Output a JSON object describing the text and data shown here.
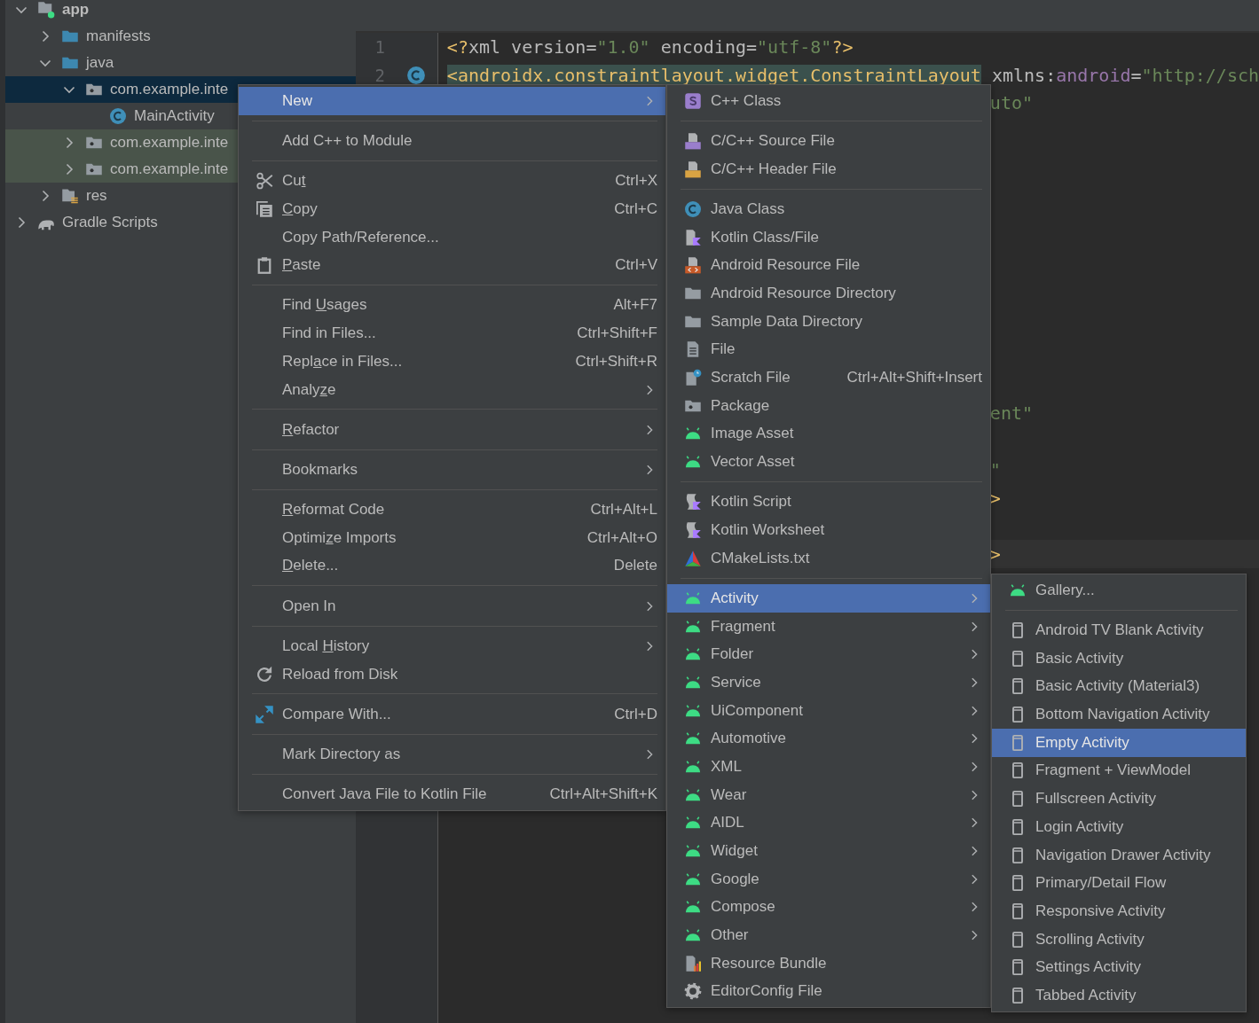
{
  "project_tree": [
    {
      "label": "app",
      "kind": "module",
      "expanded": true,
      "selected": false,
      "test": false,
      "children": [
        {
          "label": "manifests",
          "kind": "source-folder",
          "expanded": false,
          "selected": false,
          "test": false
        },
        {
          "label": "java",
          "kind": "source-folder",
          "expanded": true,
          "selected": false,
          "test": false,
          "children": [
            {
              "label": "com.example.inte",
              "kind": "package",
              "expanded": true,
              "selected": true,
              "test": false,
              "children": [
                {
                  "label": "MainActivity",
                  "kind": "class",
                  "selected": false,
                  "test": false
                }
              ]
            },
            {
              "label": "com.example.inte",
              "kind": "package",
              "expanded": false,
              "selected": false,
              "test": true
            },
            {
              "label": "com.example.inte",
              "kind": "package",
              "expanded": false,
              "selected": false,
              "test": true
            }
          ]
        },
        {
          "label": "res",
          "kind": "resources",
          "expanded": false,
          "selected": false,
          "test": false
        }
      ]
    },
    {
      "label": "Gradle Scripts",
      "kind": "gradle",
      "expanded": false,
      "selected": false,
      "test": false
    }
  ],
  "editor": {
    "lines": [
      {
        "kind": "code",
        "number": "1",
        "segments": [
          {
            "text": "<?",
            "kind": "tag"
          },
          {
            "text": "xml version=",
            "kind": "plain"
          },
          {
            "text": "\"1.0\"",
            "kind": "string"
          },
          {
            "text": " encoding=",
            "kind": "plain"
          },
          {
            "text": "\"utf-8\"",
            "kind": "string"
          },
          {
            "text": "?>",
            "kind": "tag"
          }
        ]
      },
      {
        "kind": "class-code",
        "number": "2",
        "segments": [
          {
            "text": "<androidx.constraintlayout.widget.ConstraintLayout",
            "kind": "tag",
            "highlight": true
          },
          {
            "text": " xmlns:",
            "kind": "plain"
          },
          {
            "text": "android",
            "kind": "ns"
          },
          {
            "text": "=",
            "kind": "plain"
          },
          {
            "text": "\"http://sch",
            "kind": "string"
          }
        ]
      },
      {
        "kind": "tail",
        "segments": [
          {
            "text": "uto\"",
            "kind": "string"
          }
        ]
      },
      {
        "kind": "blank"
      },
      {
        "kind": "blank"
      },
      {
        "kind": "blank"
      },
      {
        "kind": "blank"
      },
      {
        "kind": "blank"
      },
      {
        "kind": "blank"
      },
      {
        "kind": "blank"
      },
      {
        "kind": "blank"
      },
      {
        "kind": "blank"
      },
      {
        "kind": "blank"
      },
      {
        "kind": "tail",
        "segments": [
          {
            "text": "ent\"",
            "kind": "string"
          }
        ]
      },
      {
        "kind": "blank"
      },
      {
        "kind": "tail",
        "segments": [
          {
            "text": "\"",
            "kind": "string"
          }
        ]
      },
      {
        "kind": "tail",
        "segments": [
          {
            "text": ">",
            "kind": "tag"
          }
        ]
      },
      {
        "kind": "blank"
      },
      {
        "kind": "tail",
        "current": true,
        "segments": [
          {
            "text": ">",
            "kind": "tag"
          }
        ]
      }
    ]
  },
  "menus": [
    {
      "items": [
        {
          "kind": "plain",
          "label": [
            {
              "text": "New",
              "underline": false
            }
          ],
          "submenu": true,
          "selected": true
        },
        {
          "kind": "separator"
        },
        {
          "kind": "plain",
          "label": [
            {
              "text": "Add C++ to Module",
              "underline": false
            }
          ],
          "submenu": false,
          "selected": false
        },
        {
          "kind": "separator"
        },
        {
          "kind": "cut",
          "label": [
            {
              "text": "Cu",
              "underline": false
            },
            {
              "text": "t",
              "underline": true
            }
          ],
          "shortcut": "Ctrl+X",
          "submenu": false,
          "selected": false
        },
        {
          "kind": "copy",
          "label": [
            {
              "text": "C",
              "underline": true
            },
            {
              "text": "opy",
              "underline": false
            }
          ],
          "shortcut": "Ctrl+C",
          "submenu": false,
          "selected": false
        },
        {
          "kind": "plain",
          "label": [
            {
              "text": "Copy Path/Reference...",
              "underline": false
            }
          ],
          "submenu": false,
          "selected": false
        },
        {
          "kind": "paste",
          "label": [
            {
              "text": "P",
              "underline": true
            },
            {
              "text": "aste",
              "underline": false
            }
          ],
          "shortcut": "Ctrl+V",
          "submenu": false,
          "selected": false
        },
        {
          "kind": "separator"
        },
        {
          "kind": "plain",
          "label": [
            {
              "text": "Find ",
              "underline": false
            },
            {
              "text": "U",
              "underline": true
            },
            {
              "text": "sages",
              "underline": false
            }
          ],
          "shortcut": "Alt+F7",
          "submenu": false,
          "selected": false
        },
        {
          "kind": "plain",
          "label": [
            {
              "text": "Find in Files...",
              "underline": false
            }
          ],
          "shortcut": "Ctrl+Shift+F",
          "submenu": false,
          "selected": false
        },
        {
          "kind": "plain",
          "label": [
            {
              "text": "Repl",
              "underline": false
            },
            {
              "text": "a",
              "underline": true
            },
            {
              "text": "ce in Files...",
              "underline": false
            }
          ],
          "shortcut": "Ctrl+Shift+R",
          "submenu": false,
          "selected": false
        },
        {
          "kind": "plain",
          "label": [
            {
              "text": "Analy",
              "underline": false
            },
            {
              "text": "z",
              "underline": true
            },
            {
              "text": "e",
              "underline": false
            }
          ],
          "submenu": true,
          "selected": false
        },
        {
          "kind": "separator"
        },
        {
          "kind": "plain",
          "label": [
            {
              "text": "R",
              "underline": true
            },
            {
              "text": "efactor",
              "underline": false
            }
          ],
          "submenu": true,
          "selected": false
        },
        {
          "kind": "separator"
        },
        {
          "kind": "plain",
          "label": [
            {
              "text": "Bookmarks",
              "underline": false
            }
          ],
          "submenu": true,
          "selected": false
        },
        {
          "kind": "separator"
        },
        {
          "kind": "plain",
          "label": [
            {
              "text": "R",
              "underline": true
            },
            {
              "text": "eformat Code",
              "underline": false
            }
          ],
          "shortcut": "Ctrl+Alt+L",
          "submenu": false,
          "selected": false
        },
        {
          "kind": "plain",
          "label": [
            {
              "text": "Optimi",
              "underline": false
            },
            {
              "text": "z",
              "underline": true
            },
            {
              "text": "e Imports",
              "underline": false
            }
          ],
          "shortcut": "Ctrl+Alt+O",
          "submenu": false,
          "selected": false
        },
        {
          "kind": "plain",
          "label": [
            {
              "text": "D",
              "underline": true
            },
            {
              "text": "elete...",
              "underline": false
            }
          ],
          "shortcut": "Delete",
          "submenu": false,
          "selected": false
        },
        {
          "kind": "separator"
        },
        {
          "kind": "plain",
          "label": [
            {
              "text": "Open In",
              "underline": false
            }
          ],
          "submenu": true,
          "selected": false
        },
        {
          "kind": "separator"
        },
        {
          "kind": "plain",
          "label": [
            {
              "text": "Local ",
              "underline": false
            },
            {
              "text": "H",
              "underline": true
            },
            {
              "text": "istory",
              "underline": false
            }
          ],
          "submenu": true,
          "selected": false
        },
        {
          "kind": "reload",
          "label": [
            {
              "text": "Reload from Disk",
              "underline": false
            }
          ],
          "submenu": false,
          "selected": false
        },
        {
          "kind": "separator"
        },
        {
          "kind": "compare",
          "label": [
            {
              "text": "Compare With...",
              "underline": false
            }
          ],
          "shortcut": "Ctrl+D",
          "submenu": false,
          "selected": false
        },
        {
          "kind": "separator"
        },
        {
          "kind": "plain",
          "label": [
            {
              "text": "Mark Directory as",
              "underline": false
            }
          ],
          "submenu": true,
          "selected": false
        },
        {
          "kind": "separator"
        },
        {
          "kind": "plain",
          "label": [
            {
              "text": "Convert Java File to Kotlin File",
              "underline": false
            }
          ],
          "shortcut": "Ctrl+Alt+Shift+K",
          "submenu": false,
          "selected": false
        }
      ]
    },
    {
      "items": [
        {
          "kind": "cpp-class",
          "label": [
            {
              "text": "C++ Class",
              "underline": false
            }
          ],
          "submenu": false,
          "selected": false
        },
        {
          "kind": "separator"
        },
        {
          "kind": "cpp-source",
          "label": [
            {
              "text": "C/C++ Source File",
              "underline": false
            }
          ],
          "submenu": false,
          "selected": false
        },
        {
          "kind": "cpp-header",
          "label": [
            {
              "text": "C/C++ Header File",
              "underline": false
            }
          ],
          "submenu": false,
          "selected": false
        },
        {
          "kind": "separator"
        },
        {
          "kind": "class",
          "label": [
            {
              "text": "Java Class",
              "underline": false
            }
          ],
          "submenu": false,
          "selected": false
        },
        {
          "kind": "kotlin-file",
          "label": [
            {
              "text": "Kotlin Class/File",
              "underline": false
            }
          ],
          "submenu": false,
          "selected": false
        },
        {
          "kind": "resource-file",
          "label": [
            {
              "text": "Android Resource File",
              "underline": false
            }
          ],
          "submenu": false,
          "selected": false
        },
        {
          "kind": "directory",
          "label": [
            {
              "text": "Android Resource Directory",
              "underline": false
            }
          ],
          "submenu": false,
          "selected": false
        },
        {
          "kind": "directory",
          "label": [
            {
              "text": "Sample Data Directory",
              "underline": false
            }
          ],
          "submenu": false,
          "selected": false
        },
        {
          "kind": "file",
          "label": [
            {
              "text": "File",
              "underline": false
            }
          ],
          "submenu": false,
          "selected": false
        },
        {
          "kind": "scratch-file",
          "label": [
            {
              "text": "Scratch File",
              "underline": false
            }
          ],
          "shortcut": "Ctrl+Alt+Shift+Insert",
          "submenu": false,
          "selected": false
        },
        {
          "kind": "package",
          "label": [
            {
              "text": "Package",
              "underline": false
            }
          ],
          "submenu": false,
          "selected": false
        },
        {
          "kind": "android",
          "label": [
            {
              "text": "Image Asset",
              "underline": false
            }
          ],
          "submenu": false,
          "selected": false
        },
        {
          "kind": "android",
          "label": [
            {
              "text": "Vector Asset",
              "underline": false
            }
          ],
          "submenu": false,
          "selected": false
        },
        {
          "kind": "separator"
        },
        {
          "kind": "kotlin-script",
          "label": [
            {
              "text": "Kotlin Script",
              "underline": false
            }
          ],
          "submenu": false,
          "selected": false
        },
        {
          "kind": "kotlin-script",
          "label": [
            {
              "text": "Kotlin Worksheet",
              "underline": false
            }
          ],
          "submenu": false,
          "selected": false
        },
        {
          "kind": "cmake",
          "label": [
            {
              "text": "CMakeLists.txt",
              "underline": false
            }
          ],
          "submenu": false,
          "selected": false
        },
        {
          "kind": "separator"
        },
        {
          "kind": "android",
          "label": [
            {
              "text": "Activity",
              "underline": false
            }
          ],
          "submenu": true,
          "selected": true
        },
        {
          "kind": "android",
          "label": [
            {
              "text": "Fragment",
              "underline": false
            }
          ],
          "submenu": true,
          "selected": false
        },
        {
          "kind": "android",
          "label": [
            {
              "text": "Folder",
              "underline": false
            }
          ],
          "submenu": true,
          "selected": false
        },
        {
          "kind": "android",
          "label": [
            {
              "text": "Service",
              "underline": false
            }
          ],
          "submenu": true,
          "selected": false
        },
        {
          "kind": "android",
          "label": [
            {
              "text": "UiComponent",
              "underline": false
            }
          ],
          "submenu": true,
          "selected": false
        },
        {
          "kind": "android",
          "label": [
            {
              "text": "Automotive",
              "underline": false
            }
          ],
          "submenu": true,
          "selected": false
        },
        {
          "kind": "android",
          "label": [
            {
              "text": "XML",
              "underline": false
            }
          ],
          "submenu": true,
          "selected": false
        },
        {
          "kind": "android",
          "label": [
            {
              "text": "Wear",
              "underline": false
            }
          ],
          "submenu": true,
          "selected": false
        },
        {
          "kind": "android",
          "label": [
            {
              "text": "AIDL",
              "underline": false
            }
          ],
          "submenu": true,
          "selected": false
        },
        {
          "kind": "android",
          "label": [
            {
              "text": "Widget",
              "underline": false
            }
          ],
          "submenu": true,
          "selected": false
        },
        {
          "kind": "android",
          "label": [
            {
              "text": "Google",
              "underline": false
            }
          ],
          "submenu": true,
          "selected": false
        },
        {
          "kind": "android",
          "label": [
            {
              "text": "Compose",
              "underline": false
            }
          ],
          "submenu": true,
          "selected": false
        },
        {
          "kind": "android",
          "label": [
            {
              "text": "Other",
              "underline": false
            }
          ],
          "submenu": true,
          "selected": false
        },
        {
          "kind": "resource-bundle",
          "label": [
            {
              "text": "Resource Bundle",
              "underline": false
            }
          ],
          "submenu": false,
          "selected": false
        },
        {
          "kind": "settings",
          "label": [
            {
              "text": "EditorConfig File",
              "underline": false
            }
          ],
          "submenu": false,
          "selected": false
        }
      ]
    },
    {
      "items": [
        {
          "kind": "android",
          "label": [
            {
              "text": "Gallery...",
              "underline": false
            }
          ],
          "submenu": false,
          "selected": false
        },
        {
          "kind": "separator"
        },
        {
          "kind": "template",
          "label": [
            {
              "text": "Android TV Blank Activity",
              "underline": false
            }
          ],
          "submenu": false,
          "selected": false
        },
        {
          "kind": "template",
          "label": [
            {
              "text": "Basic Activity",
              "underline": false
            }
          ],
          "submenu": false,
          "selected": false
        },
        {
          "kind": "template",
          "label": [
            {
              "text": "Basic Activity (Material3)",
              "underline": false
            }
          ],
          "submenu": false,
          "selected": false
        },
        {
          "kind": "template",
          "label": [
            {
              "text": "Bottom Navigation Activity",
              "underline": false
            }
          ],
          "submenu": false,
          "selected": false
        },
        {
          "kind": "template",
          "label": [
            {
              "text": "Empty Activity",
              "underline": false
            }
          ],
          "submenu": false,
          "selected": true
        },
        {
          "kind": "template",
          "label": [
            {
              "text": "Fragment + ViewModel",
              "underline": false
            }
          ],
          "submenu": false,
          "selected": false
        },
        {
          "kind": "template",
          "label": [
            {
              "text": "Fullscreen Activity",
              "underline": false
            }
          ],
          "submenu": false,
          "selected": false
        },
        {
          "kind": "template",
          "label": [
            {
              "text": "Login Activity",
              "underline": false
            }
          ],
          "submenu": false,
          "selected": false
        },
        {
          "kind": "template",
          "label": [
            {
              "text": "Navigation Drawer Activity",
              "underline": false
            }
          ],
          "submenu": false,
          "selected": false
        },
        {
          "kind": "template",
          "label": [
            {
              "text": "Primary/Detail Flow",
              "underline": false
            }
          ],
          "submenu": false,
          "selected": false
        },
        {
          "kind": "template",
          "label": [
            {
              "text": "Responsive Activity",
              "underline": false
            }
          ],
          "submenu": false,
          "selected": false
        },
        {
          "kind": "template",
          "label": [
            {
              "text": "Scrolling Activity",
              "underline": false
            }
          ],
          "submenu": false,
          "selected": false
        },
        {
          "kind": "template",
          "label": [
            {
              "text": "Settings Activity",
              "underline": false
            }
          ],
          "submenu": false,
          "selected": false
        },
        {
          "kind": "template",
          "label": [
            {
              "text": "Tabbed Activity",
              "underline": false
            }
          ],
          "submenu": false,
          "selected": false
        }
      ]
    }
  ]
}
